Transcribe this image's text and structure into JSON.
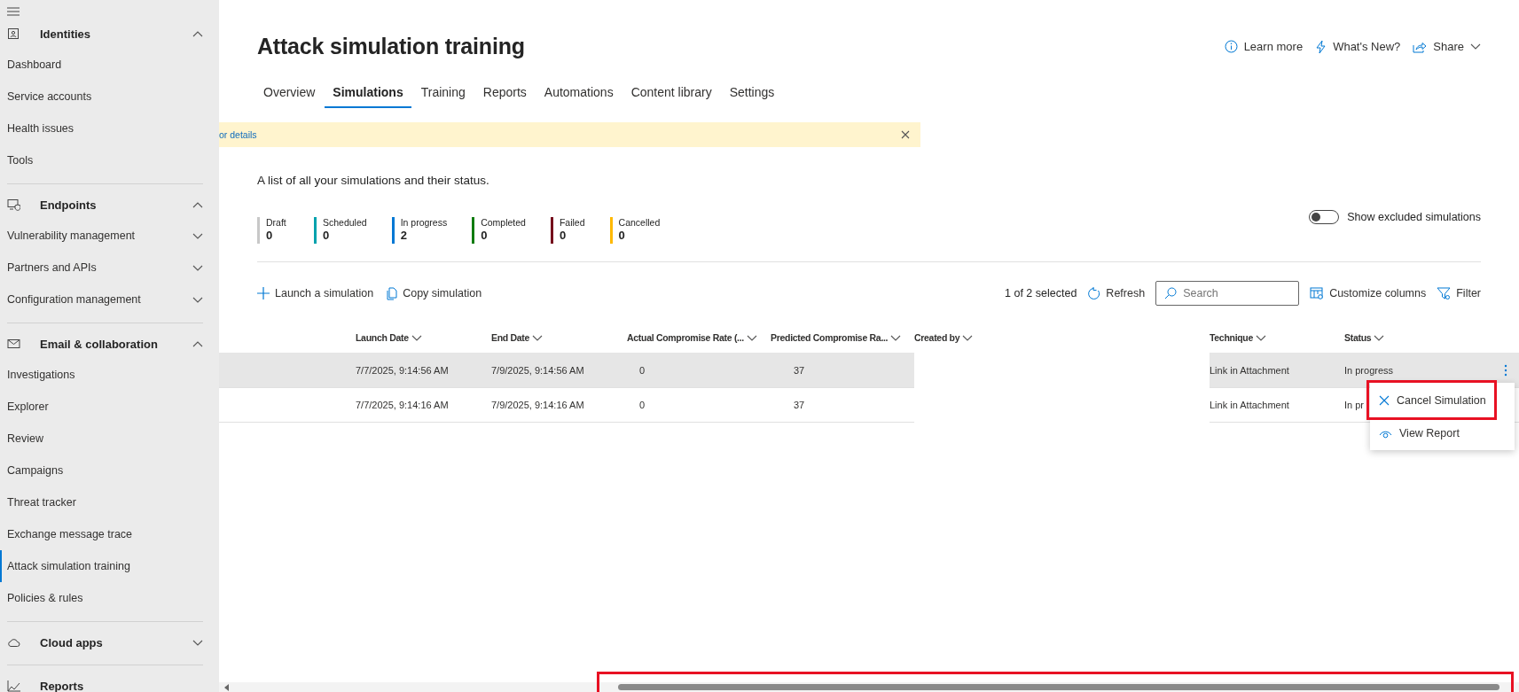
{
  "sidebar": {
    "sections": [
      {
        "title": "Identities",
        "expanded": true,
        "items": [
          {
            "label": "Dashboard",
            "kind": "link",
            "selected": false
          },
          {
            "label": "Service accounts",
            "kind": "link",
            "selected": false
          },
          {
            "label": "Health issues",
            "kind": "link",
            "selected": false
          },
          {
            "label": "Tools",
            "kind": "link",
            "selected": false
          }
        ]
      },
      {
        "title": "Endpoints",
        "expanded": true,
        "items": [
          {
            "label": "Vulnerability management",
            "kind": "group",
            "expanded": false,
            "selected": false
          },
          {
            "label": "Partners and APIs",
            "kind": "group",
            "expanded": false,
            "selected": false
          },
          {
            "label": "Configuration management",
            "kind": "group",
            "expanded": false,
            "selected": false
          }
        ]
      },
      {
        "title": "Email & collaboration",
        "expanded": true,
        "items": [
          {
            "label": "Investigations",
            "kind": "link",
            "selected": false
          },
          {
            "label": "Explorer",
            "kind": "link",
            "selected": false
          },
          {
            "label": "Review",
            "kind": "link",
            "selected": false
          },
          {
            "label": "Campaigns",
            "kind": "link",
            "selected": false
          },
          {
            "label": "Threat tracker",
            "kind": "link",
            "selected": false
          },
          {
            "label": "Exchange message trace",
            "kind": "link",
            "selected": false
          },
          {
            "label": "Attack simulation training",
            "kind": "link",
            "selected": true
          },
          {
            "label": "Policies & rules",
            "kind": "link",
            "selected": false
          }
        ]
      },
      {
        "title": "Cloud apps",
        "expanded": false
      },
      {
        "title": "Reports"
      }
    ]
  },
  "header": {
    "title": "Attack simulation training",
    "actions": [
      {
        "label": "Learn more",
        "has_menu": false
      },
      {
        "label": "What's New?",
        "has_menu": false
      },
      {
        "label": "Share",
        "has_menu": true
      }
    ]
  },
  "tabs": [
    {
      "label": "Overview",
      "selected": false
    },
    {
      "label": "Simulations",
      "selected": true
    },
    {
      "label": "Training",
      "selected": false
    },
    {
      "label": "Reports",
      "selected": false
    },
    {
      "label": "Automations",
      "selected": false
    },
    {
      "label": "Content library",
      "selected": false
    },
    {
      "label": "Settings",
      "selected": false
    }
  ],
  "banner": {
    "link": "or details"
  },
  "description": "A list of all your simulations and their status.",
  "stats": [
    {
      "label": "Draft",
      "count": "0",
      "color": "#c8c8c8"
    },
    {
      "label": "Scheduled",
      "count": "0",
      "color": "#00a2ad"
    },
    {
      "label": "In progress",
      "count": "2",
      "color": "#0078d4"
    },
    {
      "label": "Completed",
      "count": "0",
      "color": "#107c10"
    },
    {
      "label": "Failed",
      "count": "0",
      "color": "#750b1c"
    },
    {
      "label": "Cancelled",
      "count": "0",
      "color": "#ffb900"
    }
  ],
  "toggle": {
    "label": "Show excluded simulations",
    "on": false
  },
  "toolbar": {
    "left": [
      {
        "label": "Launch a simulation"
      },
      {
        "label": "Copy simulation"
      }
    ],
    "selection": "1 of 2 selected",
    "refresh": "Refresh",
    "search": {
      "placeholder": "Search"
    },
    "customize": "Customize columns",
    "filter": "Filter"
  },
  "table": {
    "columns": [
      "Launch Date",
      "End Date",
      "Actual Compromise Rate (...",
      "Predicted Compromise Ra...",
      "Created by",
      "Technique",
      "Status"
    ],
    "rows": [
      {
        "launch_date": "7/7/2025, 9:14:56 AM",
        "end_date": "7/9/2025, 9:14:56 AM",
        "actual_rate": "0",
        "predicted_rate": "37",
        "technique": "Link in Attachment",
        "status": "In progress",
        "selected": true,
        "menu_button": true
      },
      {
        "launch_date": "7/7/2025, 9:14:16 AM",
        "end_date": "7/9/2025, 9:14:16 AM",
        "actual_rate": "0",
        "predicted_rate": "37",
        "technique": "Link in Attachment",
        "status": "In pr",
        "selected": false,
        "menu_button": false
      }
    ]
  },
  "row_menu": {
    "items": [
      {
        "label": "Cancel Simulation",
        "highlighted": true
      },
      {
        "label": "View Report",
        "highlighted": false
      }
    ]
  },
  "scrollbar": {
    "highlighted": true
  }
}
